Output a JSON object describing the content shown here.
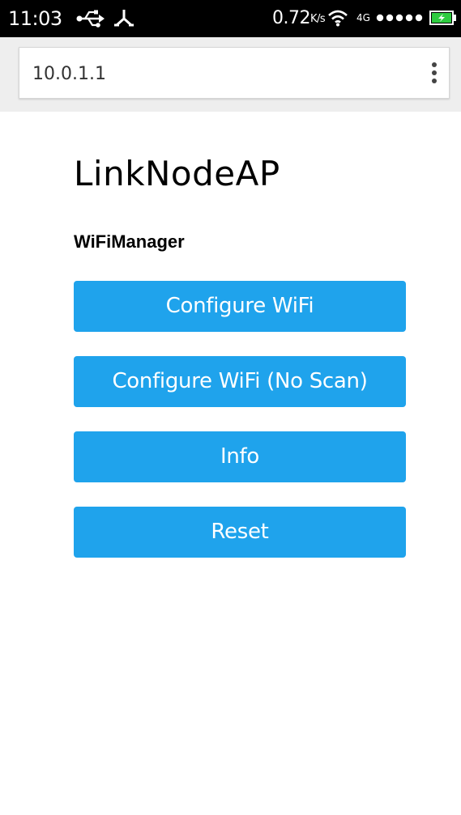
{
  "status_bar": {
    "time": "11:03",
    "speed_value": "0.72",
    "speed_unit": "K/s",
    "network": "4G",
    "icons": [
      "usb-icon",
      "debug-icon",
      "wifi-icon",
      "signal-icon",
      "battery-icon"
    ],
    "battery_color": "#2ecc40"
  },
  "browser": {
    "address": "10.0.1.1",
    "menu_icon": "more-vert-icon"
  },
  "page": {
    "title": "LinkNodeAP",
    "subtitle": "WiFiManager",
    "accent_color": "#1fa3ec",
    "buttons": [
      {
        "label": "Configure WiFi"
      },
      {
        "label": "Configure WiFi (No Scan)"
      },
      {
        "label": "Info"
      },
      {
        "label": "Reset"
      }
    ]
  }
}
